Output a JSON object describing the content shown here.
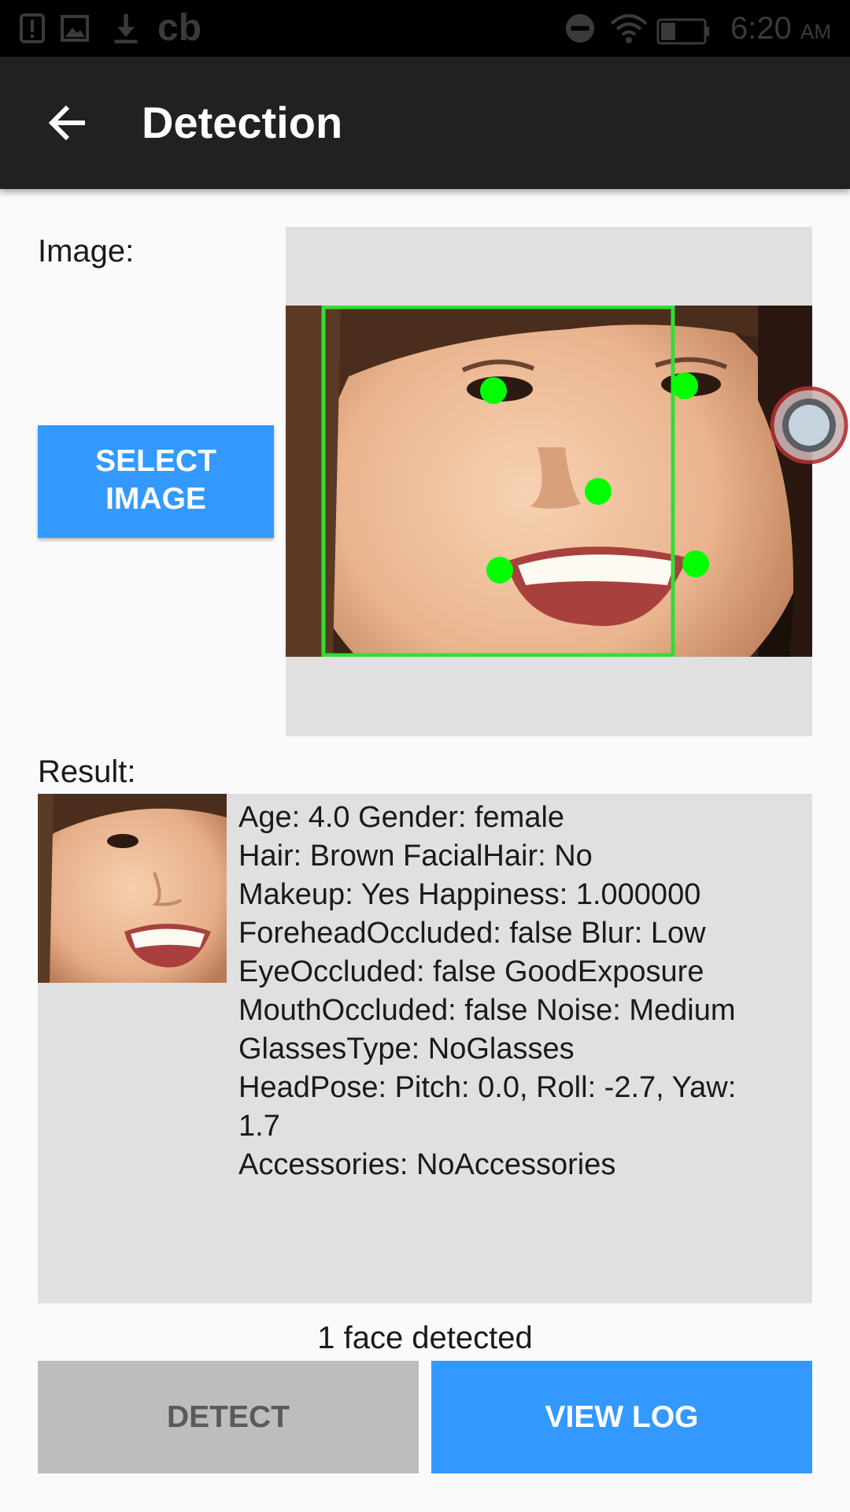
{
  "status_bar": {
    "time": "6:20",
    "ampm": "AM",
    "icons": [
      "alert-icon",
      "image-icon",
      "download-icon",
      "cb-icon",
      "dnd-icon",
      "wifi-icon",
      "battery-icon"
    ],
    "cb_text": "cb"
  },
  "app_bar": {
    "title": "Detection",
    "back_icon": "arrow-back-icon"
  },
  "image_section": {
    "label": "Image:",
    "select_button": "SELECT\nIMAGE"
  },
  "result_section": {
    "label": "Result:",
    "lines": [
      "Age: 4.0  Gender: female",
      "Hair: Brown  FacialHair: No",
      "Makeup: Yes  Happiness: 1.000000",
      "ForeheadOccluded: false  Blur: Low",
      "EyeOccluded: false  GoodExposure",
      "MouthOccluded: false  Noise: Medium",
      "GlassesType: NoGlasses",
      "HeadPose: Pitch: 0.0, Roll: -2.7, Yaw:",
      "1.7",
      "Accessories: NoAccessories"
    ]
  },
  "status_text": "1 face detected",
  "buttons": {
    "detect": "DETECT",
    "view_log": "VIEW LOG"
  },
  "colors": {
    "accent": "#3399ff",
    "app_bar": "#212121",
    "landmark": "#00ff00",
    "disabled_button": "#bdbdbd"
  }
}
